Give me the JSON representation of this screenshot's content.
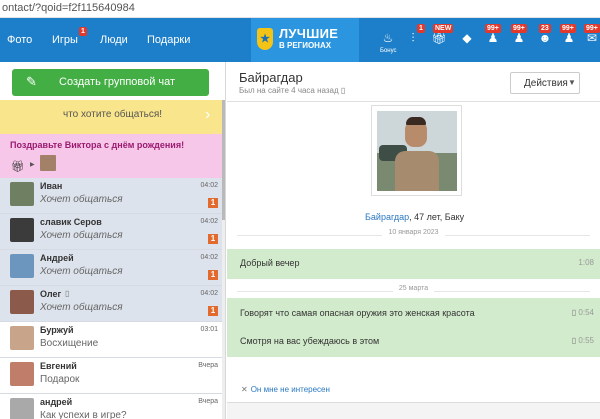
{
  "browser": {
    "url": "ontact/?qoid=f2f115640984"
  },
  "topnav": {
    "links": [
      "Фото",
      "Игры",
      "Люди",
      "Подарки"
    ],
    "games_badge": "1",
    "logo_line1": "ЛУЧШИЕ",
    "logo_line2": "В РЕГИОНАХ",
    "bonus_label": "Бонус",
    "badges": {
      "b1": "1",
      "b2": "NEW",
      "b3": "99+",
      "b4": "99+",
      "b5": "23",
      "b6": "99+",
      "b7": "99+"
    }
  },
  "sidebar": {
    "create_label": "Создать групповой чат",
    "tip_text": "что хотите общаться!",
    "birthday_text": "Поздравьте Виктора с днём рождения!",
    "chats": [
      {
        "name": "Иван",
        "message": "Хочет общаться",
        "time": "04:02",
        "unread": "1",
        "avatar_color": "#6e7f62"
      },
      {
        "name": "славик Серов",
        "message": "Хочет общаться",
        "time": "04:02",
        "unread": "1",
        "avatar_color": "#3b3b3b"
      },
      {
        "name": "Андрей",
        "message": "Хочет общаться",
        "time": "04:02",
        "unread": "1",
        "avatar_color": "#6d96bf"
      },
      {
        "name": "Олег",
        "message": "Хочет общаться",
        "time": "04:02",
        "unread": "1",
        "avatar_color": "#8b5a4a"
      },
      {
        "name": "Буржуй",
        "message": "Восхищение",
        "time": "03:01",
        "avatar_color": "#c8a58a"
      },
      {
        "name": "Евгений",
        "message": "Подарок",
        "time": "Вчера",
        "avatar_color": "#c07d6a"
      },
      {
        "name": "андрей",
        "message": "Как успехи в игре?",
        "time": "Вчера",
        "avatar_color": "#a9a9a9"
      }
    ]
  },
  "conversation": {
    "name": "Байрагдар",
    "status": "Был на сайте 4 часа назад",
    "actions_label": "Действия",
    "profile_name": "Байрагдар",
    "profile_details": ", 47 лет, Баку",
    "date1": "10 января 2023",
    "date2": "25 марта",
    "messages": [
      {
        "text": "Добрый вечер",
        "time": "1:08"
      },
      {
        "text": "Говорят что самая опасная оружия это женская красота",
        "time": "0:54"
      },
      {
        "text": "Смотря на вас убеждаюсь в этом",
        "time": "0:55"
      }
    ],
    "not_interested": "Он мне не интересен"
  },
  "colors": {
    "nav": "#1d7fc9",
    "create_button": "#43ae44",
    "incoming_bubble": "#d3ebcd",
    "unread_badge": "#e36a2f"
  }
}
